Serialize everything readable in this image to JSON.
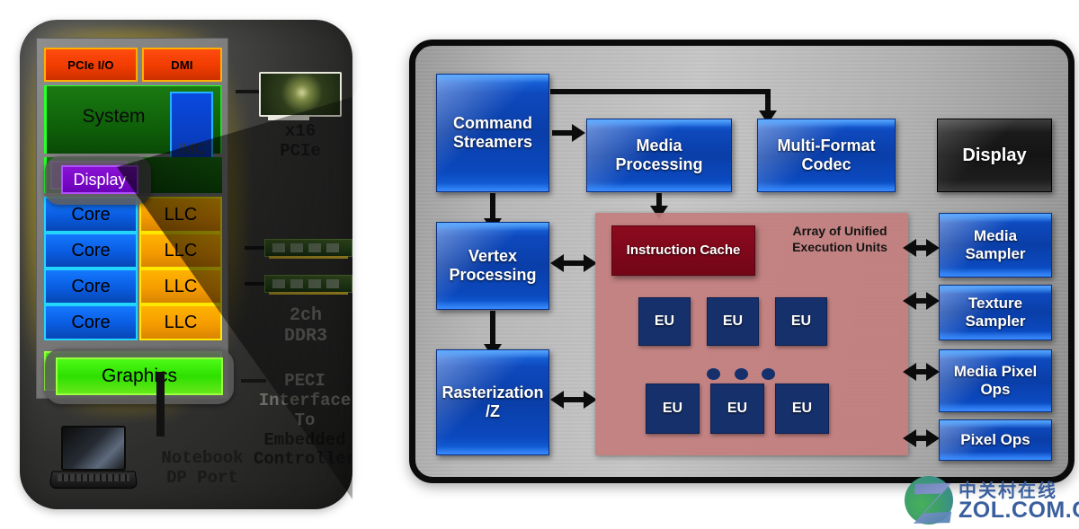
{
  "cpu_package": {
    "die_blocks": {
      "pcie_io": "PCIe I/O",
      "dmi": "DMI",
      "system": "System",
      "imc": "IMC",
      "display": "Display",
      "graphics": "Graphics"
    },
    "core_rows": [
      {
        "core": "Core",
        "llc": "LLC"
      },
      {
        "core": "Core",
        "llc": "LLC"
      },
      {
        "core": "Core",
        "llc": "LLC"
      },
      {
        "core": "Core",
        "llc": "LLC"
      }
    ],
    "peripherals": {
      "pcie_card_label": "x16\nPCIe",
      "pcie_card_label_line1": "x16",
      "pcie_card_label_line2": "PCIe",
      "dimm_label_line1": "2ch",
      "dimm_label_line2": "DDR3",
      "peci_line1": "PECI",
      "peci_line2": "Interface",
      "peci_line3": "To",
      "peci_line4": "Embedded",
      "peci_line5": "Controller",
      "notebook_line1": "Notebook",
      "notebook_line2": "DP Port"
    },
    "colors": {
      "pcie_io": "#f03c00",
      "dmi": "#f03c00",
      "system": "#0f6009",
      "imc": "#0734a8",
      "display": "#6a00b8",
      "core": "#0a5ce0",
      "llc": "#f59c00",
      "graphics": "#2ee000",
      "package": "#2f2f2e",
      "glow": "#e0c400"
    }
  },
  "gpu_diagram": {
    "blocks": {
      "command_streamers_l1": "Command",
      "command_streamers_l2": "Streamers",
      "media_processing_l1": "Media",
      "media_processing_l2": "Processing",
      "multi_format_codec_l1": "Multi-Format",
      "multi_format_codec_l2": "Codec",
      "display": "Display",
      "vertex_processing_l1": "Vertex",
      "vertex_processing_l2": "Processing",
      "rasterization_l1": "Rasterization",
      "rasterization_l2": "/Z",
      "instruction_cache": "Instruction Cache",
      "array_label_l1": "Array of Unified",
      "array_label_l2": "Execution Units",
      "media_sampler_l1": "Media",
      "media_sampler_l2": "Sampler",
      "texture_sampler_l1": "Texture",
      "texture_sampler_l2": "Sampler",
      "media_pixel_ops_l1": "Media Pixel",
      "media_pixel_ops_l2": "Ops",
      "pixel_ops": "Pixel Ops"
    },
    "execution_units": [
      "EU",
      "EU",
      "EU",
      "EU",
      "EU",
      "EU"
    ],
    "colors": {
      "block_blue": "#0a3ea8",
      "block_black": "#141414",
      "eu_navy": "#16306b",
      "instruction_cache_red": "#720617",
      "eu_array_panel": "#c47e7e",
      "frame_border": "#0b0b0b",
      "frame_fill": "#b8b8b8",
      "arrow": "#0c0c0c"
    }
  },
  "watermark": {
    "chinese": "中关村在线",
    "domain": "ZOL.COM.CN"
  }
}
